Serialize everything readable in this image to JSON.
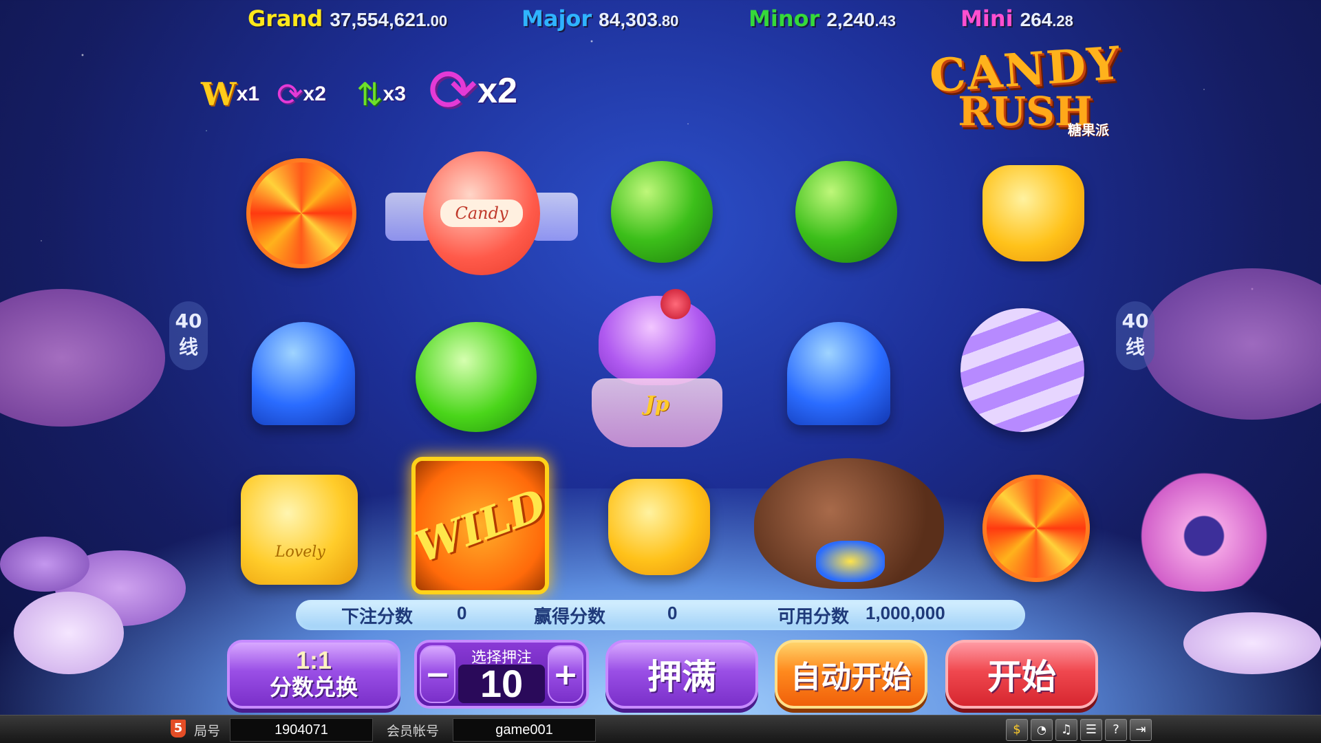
{
  "jackpots": [
    {
      "name": "Grand",
      "value_main": "37,554,621",
      "value_cents": ".00",
      "color": "#ffe81a"
    },
    {
      "name": "Major",
      "value_main": "84,303",
      "value_cents": ".80",
      "color": "#2fb4ff"
    },
    {
      "name": "Minor",
      "value_main": "2,240",
      "value_cents": ".43",
      "color": "#35d93a"
    },
    {
      "name": "Mini",
      "value_main": "264",
      "value_cents": ".28",
      "color": "#ff4fd0"
    }
  ],
  "modifiers": [
    {
      "icon": "wild-w-icon",
      "glyph": "W",
      "label": "x1"
    },
    {
      "icon": "refresh-pink-icon",
      "glyph": "⟳",
      "label": "x2"
    },
    {
      "icon": "swap-arrows-icon",
      "glyph": "⇅",
      "label": "x3"
    },
    {
      "icon": "refresh-large-icon",
      "glyph": "⟳",
      "label": "x2"
    }
  ],
  "logo": {
    "line1": "CANDY",
    "line2": "RUSH",
    "chinese": "糖果派"
  },
  "lines_left": {
    "num": "40",
    "unit": "线"
  },
  "lines_right": {
    "num": "40",
    "unit": "线"
  },
  "reel_labels": {
    "candy_wrapper": "Candy",
    "jp_cup": "Jp",
    "lovely": "Lovely",
    "wild": "WILD"
  },
  "info": {
    "bet_label": "下注分数",
    "bet_value": "0",
    "win_label": "赢得分数",
    "win_value": "0",
    "credit_label": "可用分数",
    "credit_value": "1,000,000"
  },
  "controls": {
    "exchange_ratio": "1:1",
    "exchange_label": "分数兑换",
    "bet_select_label": "选择押注",
    "bet_minus": "−",
    "bet_value": "10",
    "bet_plus": "+",
    "max_bet": "押满",
    "auto_start": "自动开始",
    "start": "开始"
  },
  "statusbar": {
    "html5": "5",
    "room_label": "局号",
    "room_value": "1904071",
    "account_label": "会员帐号",
    "account_value": "game001",
    "icons": [
      "coin-bag-icon",
      "rss-icon",
      "music-icon",
      "settings-icon",
      "help-icon",
      "exit-icon"
    ]
  }
}
